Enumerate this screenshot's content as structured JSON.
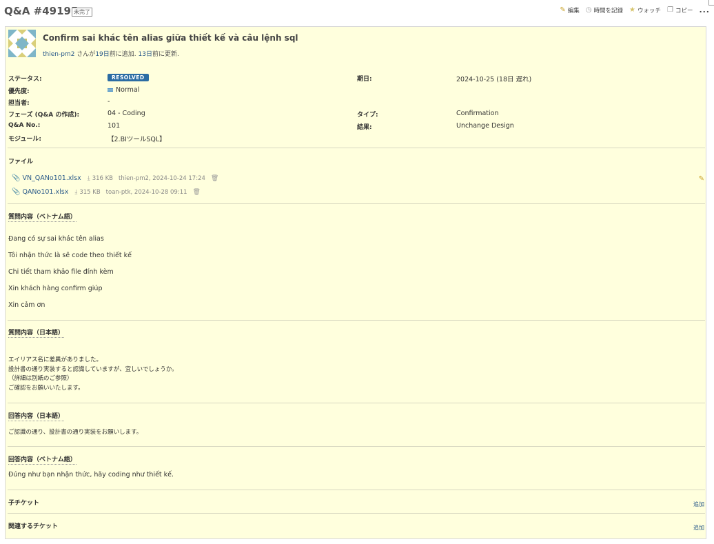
{
  "header": {
    "title": "Q&A #49195",
    "status_tag": "未完了",
    "actions": {
      "edit": "編集",
      "log_time": "時間を記録",
      "watch": "ウォッチ",
      "copy": "コピー",
      "more": "..."
    }
  },
  "issue": {
    "subject": "Confirm sai khác tên alias giữa thiết kế và câu lệnh sql",
    "author": "thien-pm2",
    "author_suffix": " さんが",
    "added_ago": "19日",
    "added_text": "前に追加. ",
    "updated_ago": "13日",
    "updated_text": "前に更新."
  },
  "attributes": {
    "status": {
      "label": "ステータス:",
      "value": "RESOLVED"
    },
    "priority": {
      "label": "優先度:",
      "value": "Normal"
    },
    "assignee": {
      "label": "担当者:",
      "value": "-"
    },
    "phase": {
      "label": "フェーズ (Q&A の作成):",
      "value": "04 - Coding"
    },
    "qa_no": {
      "label": "Q&A No.:",
      "value": "101"
    },
    "module": {
      "label": "モジュール:",
      "value": "【2.BIツールSQL】"
    },
    "due_date": {
      "label": "期日:",
      "value": "2024-10-25 (18日 遅れ)"
    },
    "type": {
      "label": "タイプ:",
      "value": "Confirmation"
    },
    "result": {
      "label": "結果:",
      "value": "Unchange Design"
    }
  },
  "files": {
    "title": "ファイル",
    "items": [
      {
        "name": "VN_QANo101.xlsx",
        "size": "316 KB",
        "meta": "thien-pm2, 2024-10-24 17:24"
      },
      {
        "name": "QANo101.xlsx",
        "size": "315 KB",
        "meta": "toan-ptk, 2024-10-28 09:11"
      }
    ]
  },
  "question_vn": {
    "title": "質問内容（ベトナム語）",
    "lines": [
      "Đang có sự sai khác tên alias",
      "Tôi nhận thức là sẽ code theo thiết kế",
      "Chi tiết tham khảo file đính kèm",
      "Xin khách hàng confirm giúp",
      "Xin cảm ơn"
    ]
  },
  "question_jp": {
    "title": "質問内容（日本語）",
    "lines": [
      "エイリアス名に差異がありました。",
      "設計書の通り実装すると認識していますが、宜しいでしょうか。",
      "（詳細は別紙のご参照）",
      "ご確認をお願いいたします。"
    ]
  },
  "answer_jp": {
    "title": "回答内容（日本語）",
    "text": "ご認識の通り、設計書の通り実装をお願いします。"
  },
  "answer_vn": {
    "title": "回答内容（ベトナム語）",
    "text": "Đúng như bạn nhận thức, hãy coding như thiết kế."
  },
  "subtasks": {
    "title": "子チケット",
    "add": "追加"
  },
  "related": {
    "title": "関連するチケット",
    "add": "追加"
  },
  "colors": {
    "panel_bg": "#ffffdd",
    "badge": "#2b6ca3",
    "link": "#2a5a8a"
  }
}
